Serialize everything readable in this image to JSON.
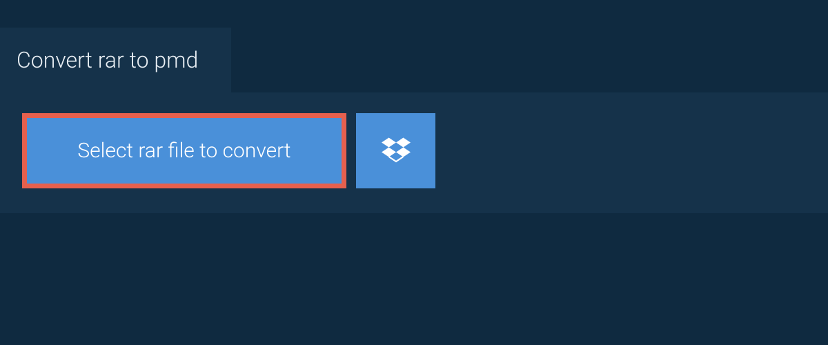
{
  "tab": {
    "title": "Convert rar to pmd"
  },
  "actions": {
    "select_file_label": "Select rar file to convert"
  }
}
